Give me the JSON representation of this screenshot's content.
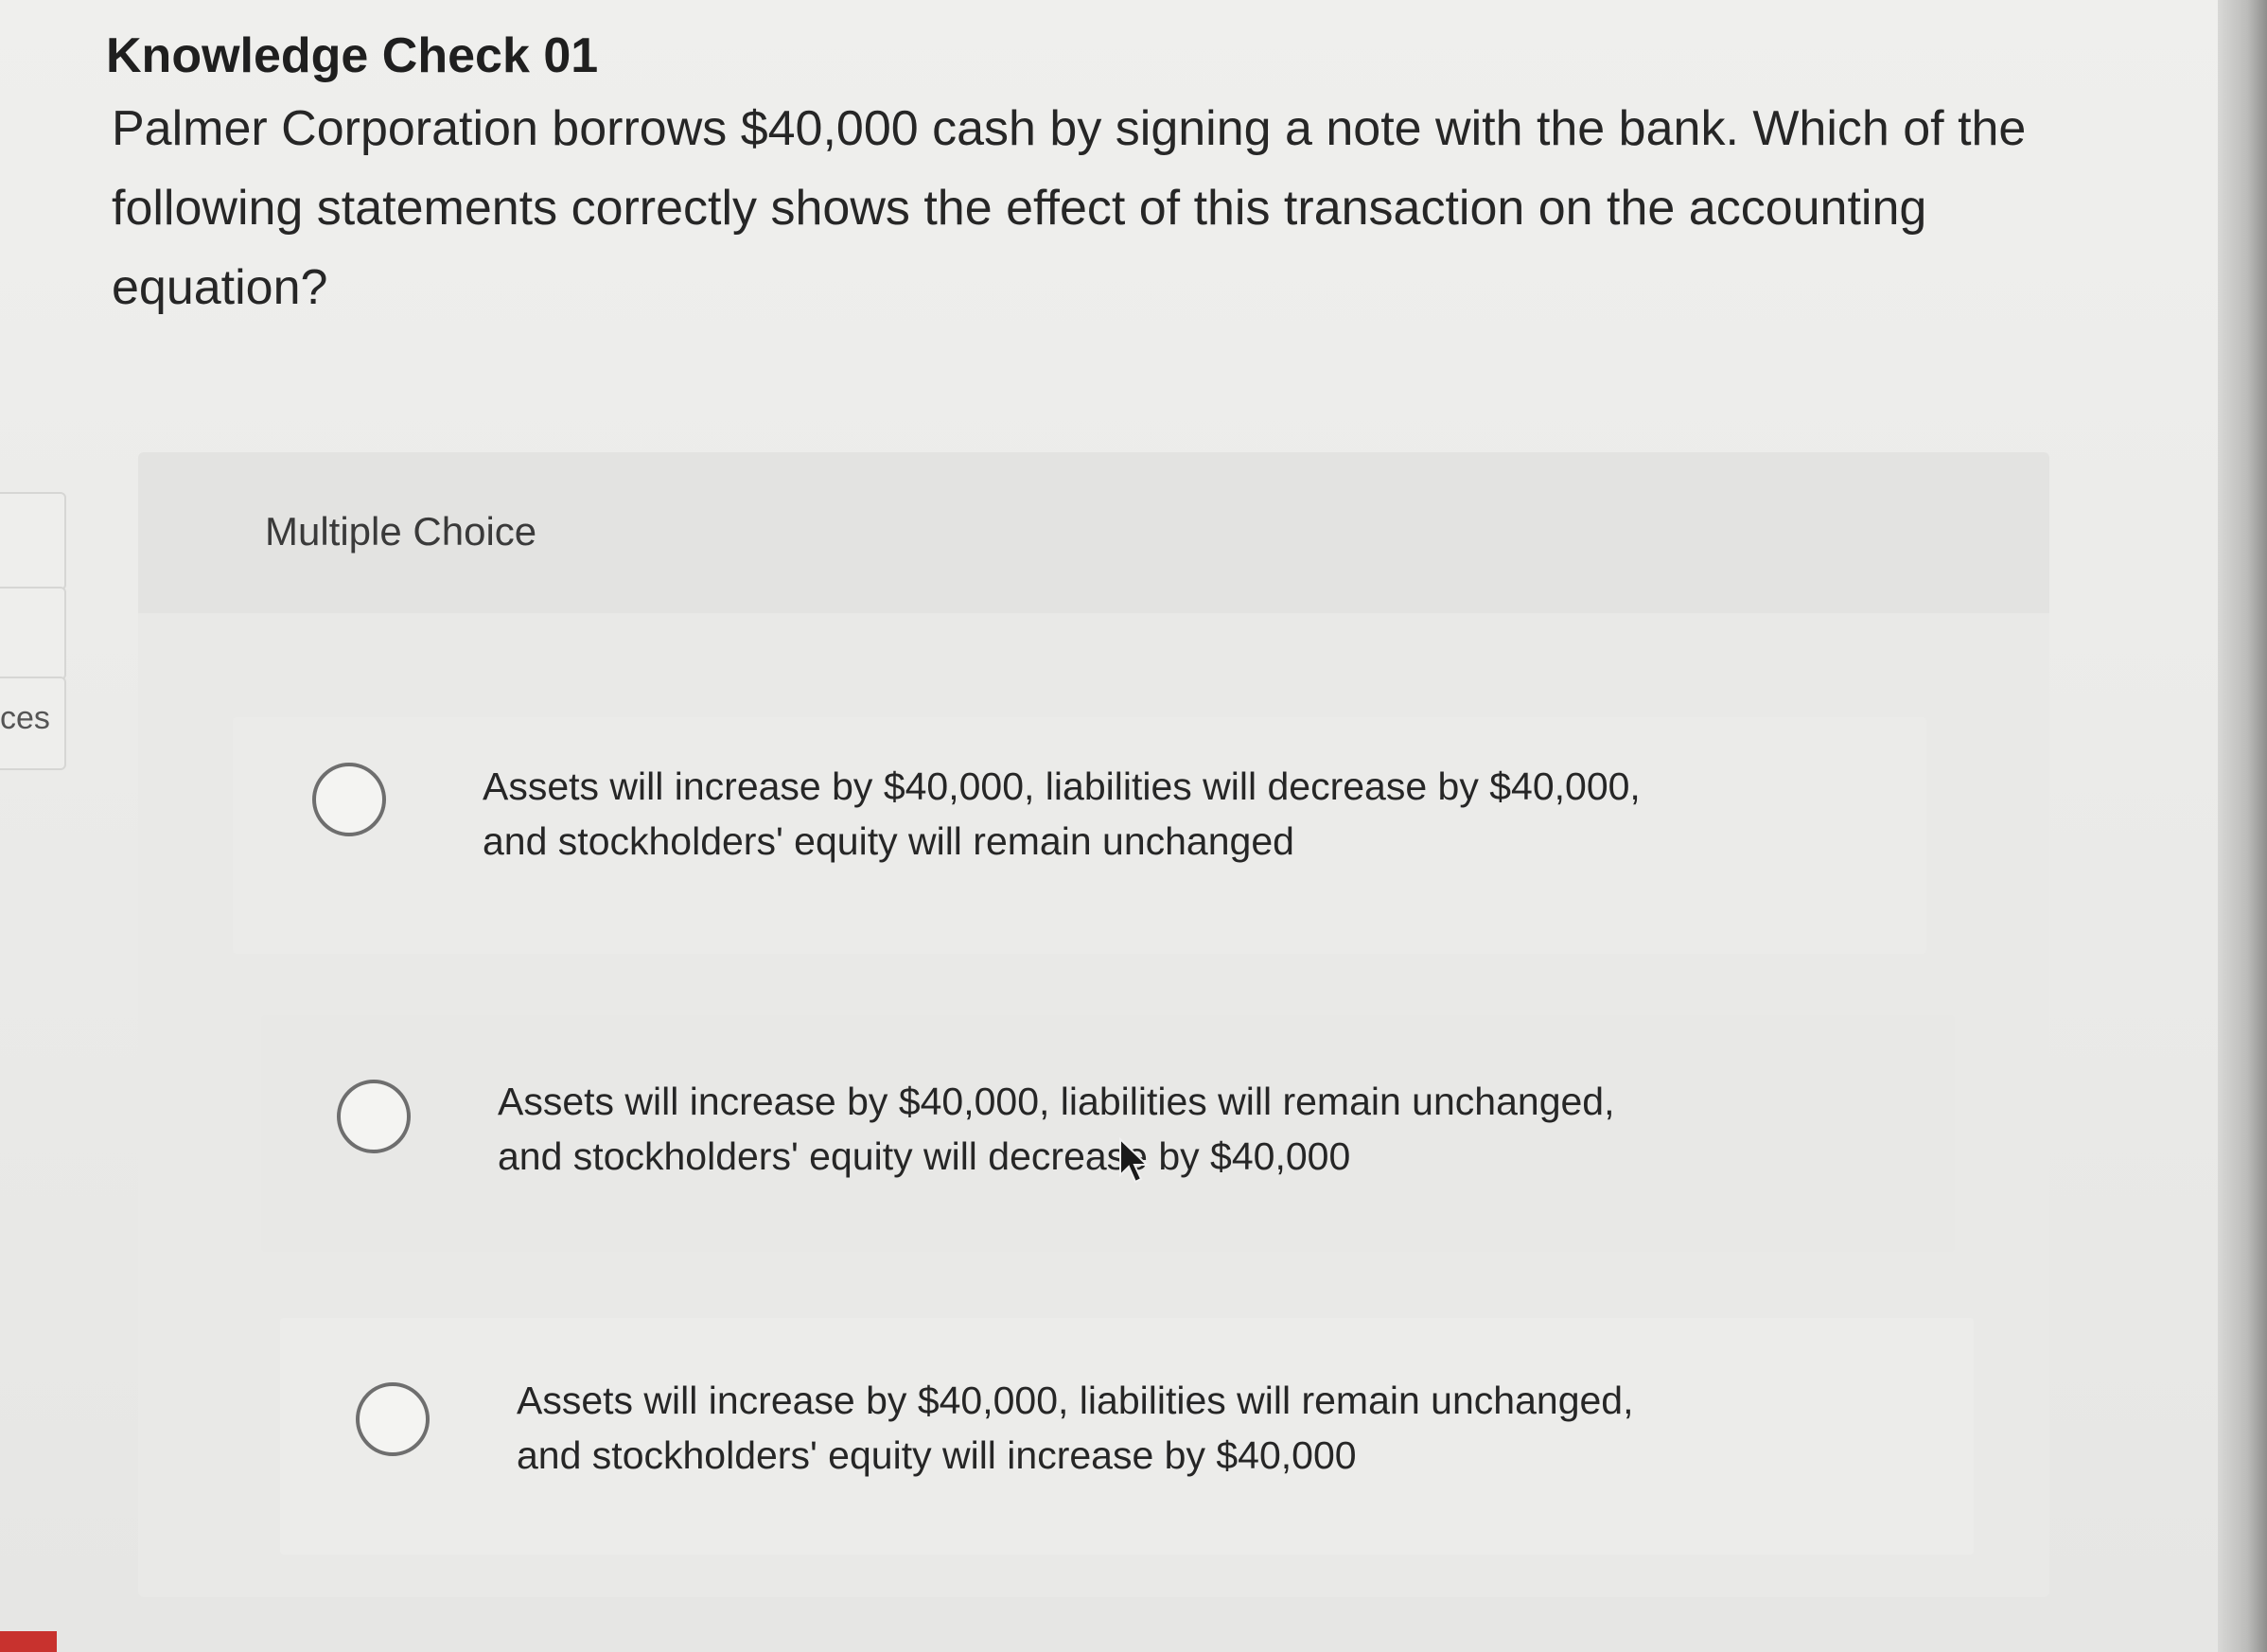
{
  "question": {
    "title": "Knowledge Check 01",
    "text": "Palmer Corporation borrows $40,000 cash by signing a note with the bank. Which of the following statements correctly shows the effect of this transaction on the accounting equation?"
  },
  "left_rail": {
    "tab_label": "ces"
  },
  "multiple_choice": {
    "header": "Multiple Choice",
    "options": [
      {
        "label": "Assets will increase by $40,000, liabilities will decrease by $40,000, and stockholders' equity will remain unchanged",
        "selected": false
      },
      {
        "label": "Assets will increase by $40,000, liabilities will remain unchanged, and stockholders' equity will decrease by $40,000",
        "selected": false
      },
      {
        "label": "Assets will increase by $40,000, liabilities will remain unchanged, and stockholders' equity will increase by $40,000",
        "selected": false
      }
    ]
  },
  "colors": {
    "background": "#ececea",
    "panel": "#e9e9e7",
    "radio_border": "#6e6e6e",
    "text": "#262626"
  }
}
